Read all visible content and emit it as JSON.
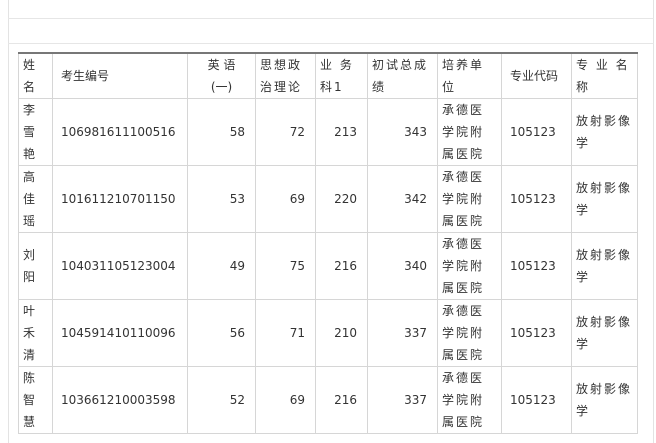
{
  "table": {
    "headers": {
      "name": "姓名",
      "exam_id": "考生编号",
      "english_top": "英 语",
      "english_bottom": "(一)",
      "politics": "思想政治理论",
      "professional1": "业 务 科1",
      "total": "初试总成绩",
      "unit": "培养单位",
      "major_code": "专业代码",
      "major_name": "专 业 名 称"
    },
    "rows": [
      {
        "name": "李雪艳",
        "exam_id": "106981611100516",
        "english": "58",
        "politics": "72",
        "professional1": "213",
        "total": "343",
        "unit": "承德医学院附属医院",
        "major_code": "105123",
        "major_name": "放射影像学"
      },
      {
        "name": "高佳瑶",
        "exam_id": "101611210701150",
        "english": "53",
        "politics": "69",
        "professional1": "220",
        "total": "342",
        "unit": "承德医学院附属医院",
        "major_code": "105123",
        "major_name": "放射影像学"
      },
      {
        "name": "刘阳",
        "exam_id": "104031105123004",
        "english": "49",
        "politics": "75",
        "professional1": "216",
        "total": "340",
        "unit": "承德医学院附属医院",
        "major_code": "105123",
        "major_name": "放射影像学"
      },
      {
        "name": "叶禾清",
        "exam_id": "104591410110096",
        "english": "56",
        "politics": "71",
        "professional1": "210",
        "total": "337",
        "unit": "承德医学院附属医院",
        "major_code": "105123",
        "major_name": "放射影像学"
      },
      {
        "name": "陈智慧",
        "exam_id": "103661210003598",
        "english": "52",
        "politics": "69",
        "professional1": "216",
        "total": "337",
        "unit": "承德医学院附属医院",
        "major_code": "105123",
        "major_name": "放射影像学"
      }
    ]
  }
}
